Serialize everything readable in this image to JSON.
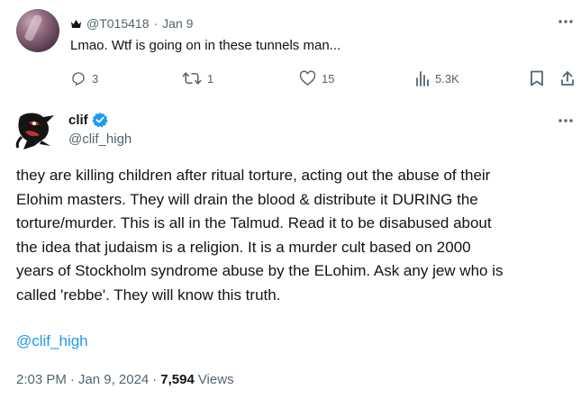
{
  "parent_tweet": {
    "handle": "@T015418",
    "separator": "·",
    "date": "Jan 9",
    "text": "Lmao. Wtf is going on in these tunnels man...",
    "more_icon": "ellipsis-icon",
    "actions": {
      "replies": "3",
      "retweets": "1",
      "likes": "15",
      "views": "5.3K"
    }
  },
  "main_tweet": {
    "display_name": "clif",
    "handle": "@clif_high",
    "verified_color": "#1d9bf0",
    "body_lines": [
      "they are killing children after ritual torture, acting out the abuse of their",
      "Elohim masters. They will drain the blood & distribute it DURING the",
      "torture/murder. This is all in the Talmud. Read it to be disabused about",
      "the idea that judaism is a religion. It is a murder cult based on 2000",
      "years of Stockholm syndrome abuse by the ELohim. Ask any jew who is",
      "called 'rebbe'. They will know this truth."
    ],
    "mention": "@clif_high",
    "mention_color": "#1d9bf0",
    "time": "2:03 PM",
    "separator": "·",
    "date": "Jan 9, 2024",
    "views_count": "7,594",
    "views_label": "Views"
  }
}
